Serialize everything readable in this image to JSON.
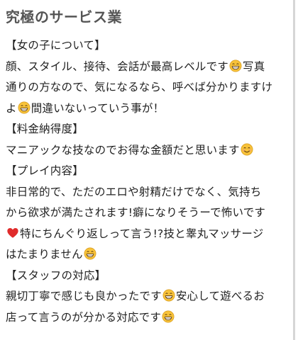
{
  "title": "究極のサービス業",
  "review": {
    "lines": [
      [
        {
          "t": "【女の子について】"
        }
      ],
      [
        {
          "t": "顔、スタイル、接待、会話が最高レベルです"
        },
        {
          "e": "grin"
        },
        {
          "t": "写真"
        }
      ],
      [
        {
          "t": "通りの方なので、気になるなら、呼べば分かりますけ"
        }
      ],
      [
        {
          "t": "よ"
        },
        {
          "e": "grin"
        },
        {
          "t": "間違いないっていう事が！"
        }
      ],
      [
        {
          "t": "【料金納得度】"
        }
      ],
      [
        {
          "t": "マニアックな技なのでお得な金額だと思います"
        },
        {
          "e": "smile"
        }
      ],
      [
        {
          "t": "【プレイ内容】"
        }
      ],
      [
        {
          "t": "非日常的で、ただのエロや射精だけでなく、気持ち"
        }
      ],
      [
        {
          "t": "から欲求が満たされます!癖になりそうーで怖いです"
        }
      ],
      [
        {
          "e": "heart"
        },
        {
          "t": "特にちんぐり返しって言う!?技と睾丸マッサージ"
        }
      ],
      [
        {
          "t": "はたまりません"
        },
        {
          "e": "grin"
        }
      ],
      [
        {
          "t": "【スタッフの対応】"
        }
      ],
      [
        {
          "t": "親切丁寧で感じも良かったです"
        },
        {
          "e": "grin"
        },
        {
          "t": "安心して遊べるお"
        }
      ],
      [
        {
          "t": "店って言うのが分かる対応です"
        },
        {
          "e": "grin"
        }
      ]
    ]
  },
  "icons": {
    "grin": "grinning-face-icon",
    "smile": "smiling-face-icon",
    "heart": "red-heart-icon"
  },
  "colors": {
    "title": "#555555",
    "text": "#222222",
    "emoji_face": "#f7c23a",
    "heart": "#e02b2b"
  }
}
